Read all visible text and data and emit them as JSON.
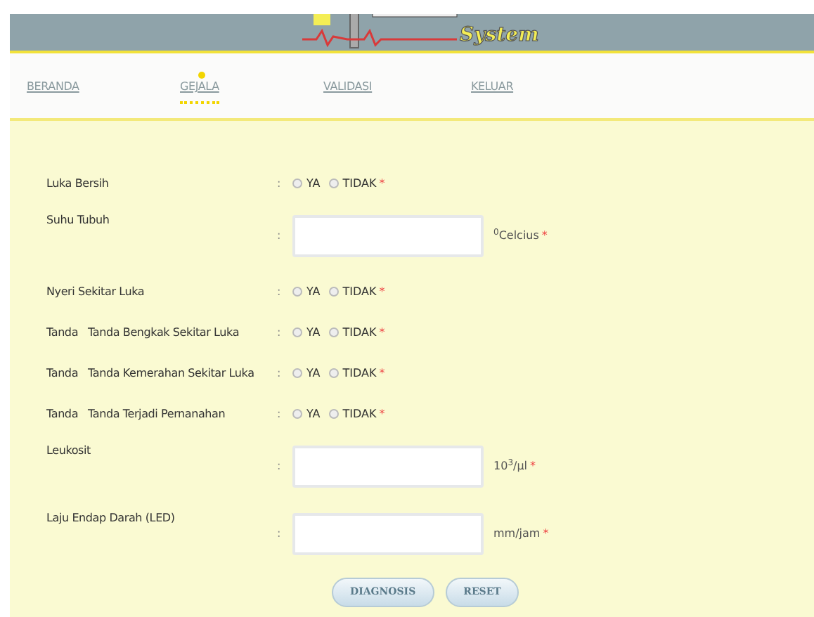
{
  "header": {
    "logo_text": "System"
  },
  "nav": [
    {
      "label": "BERANDA",
      "selected": false
    },
    {
      "label": "GEJALA",
      "selected": true
    },
    {
      "label": "VALIDASI",
      "selected": false
    },
    {
      "label": "KELUAR",
      "selected": false
    }
  ],
  "form": {
    "separator": ":",
    "rows": [
      {
        "kind": "radio",
        "label": "Luka Bersih",
        "options": [
          {
            "label": "YA",
            "selected": false
          },
          {
            "label": "TIDAK",
            "selected": false
          }
        ],
        "required_mark": "*"
      },
      {
        "kind": "input",
        "label": "Suhu Tubuh",
        "unit": "$^{0}$Celcius",
        "required_mark": "*"
      },
      {
        "kind": "radio",
        "label": "Nyeri Sekitar Luka",
        "options": [
          {
            "label": "YA",
            "selected": false
          },
          {
            "label": "TIDAK",
            "selected": false
          }
        ],
        "required_mark": "*"
      },
      {
        "kind": "radio",
        "label": "Tanda   Tanda Bengkak Sekitar Luka",
        "options": [
          {
            "label": "YA",
            "selected": false
          },
          {
            "label": "TIDAK",
            "selected": false
          }
        ],
        "required_mark": "*"
      },
      {
        "kind": "radio",
        "label": "Tanda   Tanda Kemerahan Sekitar Luka",
        "options": [
          {
            "label": "YA",
            "selected": false
          },
          {
            "label": "TIDAK",
            "selected": false
          }
        ],
        "required_mark": "*"
      },
      {
        "kind": "radio",
        "label": "Tanda   Tanda Terjadi Pernanahan",
        "options": [
          {
            "label": "YA",
            "selected": false
          },
          {
            "label": "TIDAK",
            "selected": false
          }
        ],
        "required_mark": "*"
      },
      {
        "kind": "input",
        "label": "Leukosit",
        "unit": "10$^{3}$/μl",
        "required_mark": "*"
      },
      {
        "kind": "input",
        "label": "Laju Endap Darah (LED)",
        "unit": "mm/jam",
        "required_mark": "*"
      }
    ],
    "buttons": [
      "DIAGNOSIS",
      "RESET"
    ]
  }
}
